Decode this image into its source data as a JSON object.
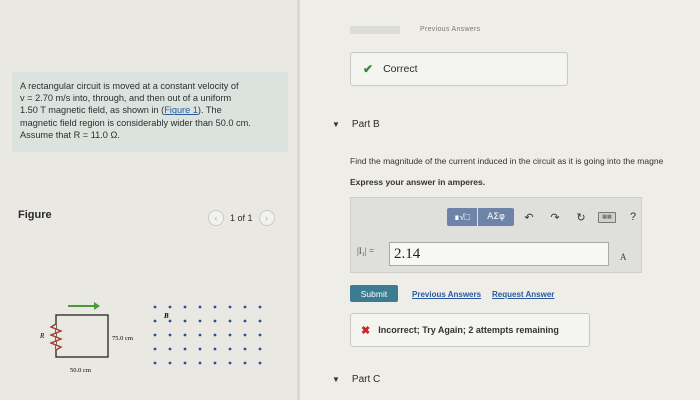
{
  "problem": {
    "line1": "A rectangular circuit is moved at a constant velocity of",
    "line2": "v = 2.70 m/s into, through, and then out of a uniform",
    "line3_pre": "1.50 T magnetic field, as shown in (",
    "line3_link": "Figure 1",
    "line3_post": "). The",
    "line4": "magnetic field region is considerably wider than 50.0 cm.",
    "line5": "Assume that R = 11.0 Ω."
  },
  "figure": {
    "title": "Figure",
    "pager": "1 of 1",
    "prev_icon": "chevron-left-icon",
    "next_icon": "chevron-right-icon",
    "label_R": "R",
    "label_B": "B",
    "label_width": "50.0 cm",
    "label_height": "75.0 cm"
  },
  "top": {
    "previous_answers": "Previous Answers"
  },
  "feedback_correct": {
    "icon": "check-icon",
    "text": "Correct"
  },
  "part_b": {
    "title": "Part B",
    "question": "Find the magnitude of the current induced in the circuit as it is going into the magne",
    "instruction": "Express your answer in amperes.",
    "toolbar": {
      "math_label": "∎√□",
      "greek_label": "ΑΣφ",
      "undo_icon": "undo-icon",
      "redo_icon": "redo-icon",
      "reset_icon": "reset-icon",
      "keyboard_icon": "keyboard-icon",
      "help_label": "?"
    },
    "answer_label": "|I₁| =",
    "answer_value": "2.14",
    "unit": "A",
    "submit_label": "Submit",
    "previous_answers_label": "Previous Answers",
    "request_answer_label": "Request Answer"
  },
  "feedback_incorrect": {
    "icon": "x-icon",
    "text": "Incorrect; Try Again; 2 attempts remaining"
  },
  "part_c": {
    "title": "Part C"
  },
  "colors": {
    "accent": "#3b7c93",
    "toolbar": "#6d83a8",
    "correct": "#2e8b3a",
    "incorrect": "#c62828",
    "problem_bg": "#dbe3df"
  }
}
